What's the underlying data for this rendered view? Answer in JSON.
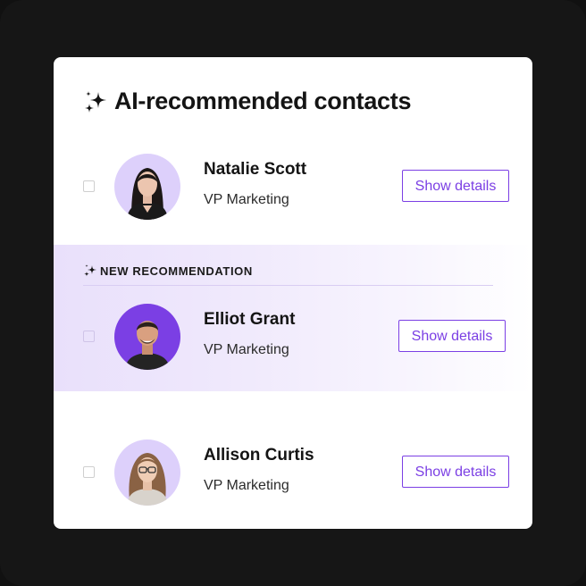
{
  "card": {
    "title": "AI-recommended contacts",
    "title_icon": "sparkles-icon"
  },
  "new_recommendation": {
    "label": "NEW RECOMMENDATION",
    "icon": "sparkles-icon"
  },
  "contacts": [
    {
      "name": "Natalie Scott",
      "role": "VP Marketing",
      "button_label": "Show details",
      "checked": false,
      "avatar_bg": "#ddd0fb",
      "highlighted": false
    },
    {
      "name": "Elliot Grant",
      "role": "VP Marketing",
      "button_label": "Show details",
      "checked": false,
      "avatar_bg": "#7b3fe4",
      "highlighted": true
    },
    {
      "name": "Allison Curtis",
      "role": "VP Marketing",
      "button_label": "Show details",
      "checked": false,
      "avatar_bg": "#ddd0fb",
      "highlighted": false
    }
  ],
  "colors": {
    "accent": "#7b3fe4",
    "background": "#161616",
    "card": "#ffffff",
    "highlight": "#e9e0fb"
  }
}
